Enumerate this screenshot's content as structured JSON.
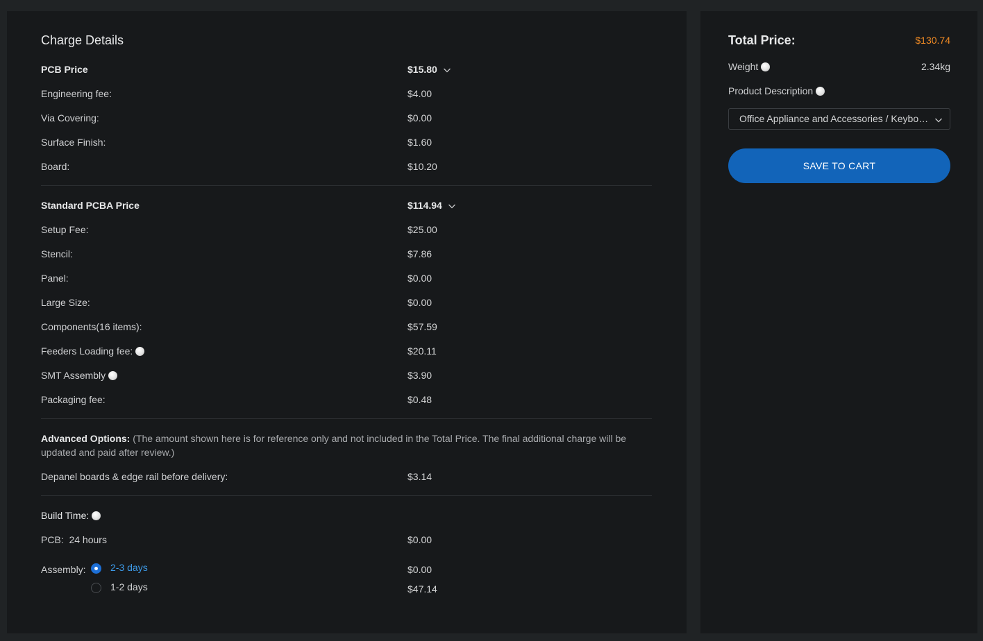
{
  "charge_details": {
    "title": "Charge Details",
    "pcb": {
      "label": "PCB Price",
      "value": "$15.80",
      "rows": [
        {
          "label": "Engineering fee:",
          "value": "$4.00"
        },
        {
          "label": "Via Covering:",
          "value": "$0.00"
        },
        {
          "label": "Surface Finish:",
          "value": "$1.60"
        },
        {
          "label": "Board:",
          "value": "$10.20"
        }
      ]
    },
    "pcba": {
      "label": "Standard PCBA Price",
      "value": "$114.94",
      "rows": [
        {
          "label": "Setup Fee:",
          "value": "$25.00"
        },
        {
          "label": "Stencil:",
          "value": "$7.86"
        },
        {
          "label": "Panel:",
          "value": "$0.00"
        },
        {
          "label": "Large Size:",
          "value": "$0.00"
        },
        {
          "label": "Components(16 items):",
          "value": "$57.59"
        },
        {
          "label": "Feeders Loading fee:",
          "value": "$20.11"
        },
        {
          "label": "SMT Assembly",
          "value": "$3.90"
        },
        {
          "label": "Packaging fee:",
          "value": "$0.48"
        }
      ]
    },
    "advanced": {
      "label": "Advanced Options:",
      "note": "(The amount shown here is for reference only and not included in the Total Price. The final additional charge will be updated and paid after review.)",
      "row_label": "Depanel boards & edge rail before delivery:",
      "row_value": "$3.14"
    },
    "build_time": {
      "label": "Build Time:",
      "pcb_label": "PCB:",
      "pcb_time": "24 hours",
      "pcb_value": "$0.00",
      "assembly_label": "Assembly:",
      "options": [
        {
          "label": "2-3 days",
          "value": "$0.00",
          "selected": true
        },
        {
          "label": "1-2 days",
          "value": "$47.14",
          "selected": false
        }
      ]
    }
  },
  "summary": {
    "total_label": "Total Price:",
    "total_value": "$130.74",
    "weight_label": "Weight",
    "weight_value": "2.34kg",
    "product_desc_label": "Product Description",
    "product_desc_value": "Office Appliance and Accessories / Keyboard",
    "save_button": "SAVE TO CART"
  },
  "colors": {
    "background": "#202325",
    "panel": "#17191b",
    "accent_blue": "#1264b9",
    "total_orange": "#f08a24",
    "selected_radio_text": "#3d9be9"
  },
  "icons": [
    "chevron-down-icon",
    "info-icon",
    "radio-icon"
  ]
}
